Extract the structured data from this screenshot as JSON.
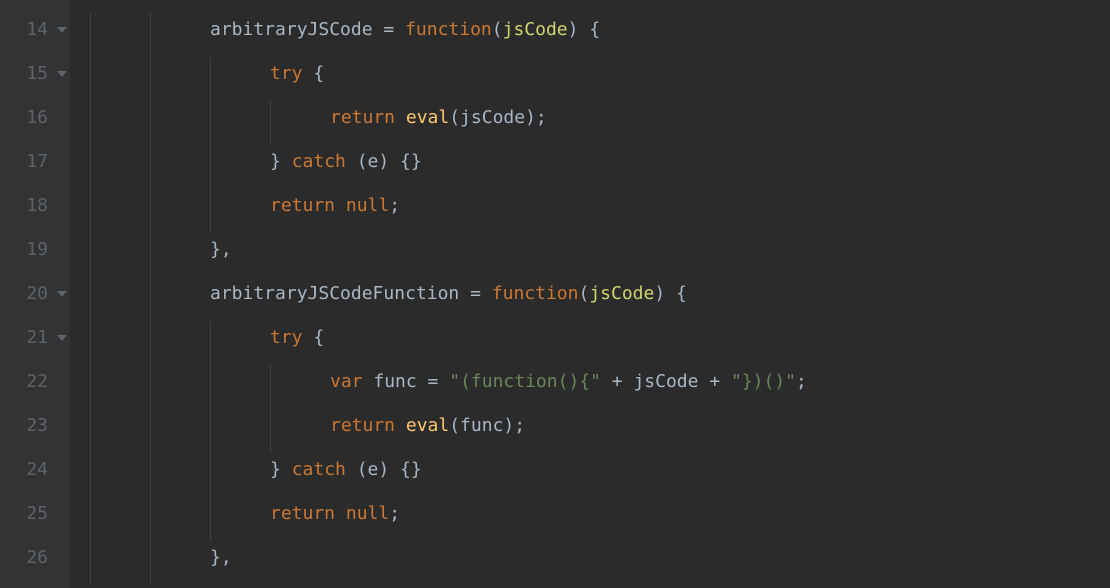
{
  "gutter": {
    "start": 14,
    "end": 26,
    "foldable": [
      14,
      15,
      20,
      21
    ]
  },
  "code": {
    "lines": [
      {
        "n": 14,
        "indent": 2,
        "tokens": [
          {
            "t": "arbitraryJSCode ",
            "c": "tk-default"
          },
          {
            "t": "= ",
            "c": "tk-op"
          },
          {
            "t": "function",
            "c": "tk-keyword"
          },
          {
            "t": "(",
            "c": "tk-paren"
          },
          {
            "t": "jsCode",
            "c": "tk-param"
          },
          {
            "t": ") {",
            "c": "tk-paren"
          }
        ]
      },
      {
        "n": 15,
        "indent": 3,
        "tokens": [
          {
            "t": "try",
            "c": "tk-keyword"
          },
          {
            "t": " {",
            "c": "tk-brace"
          }
        ]
      },
      {
        "n": 16,
        "indent": 4,
        "tokens": [
          {
            "t": "return ",
            "c": "tk-keyword"
          },
          {
            "t": "eval",
            "c": "tk-func"
          },
          {
            "t": "(jsCode);",
            "c": "tk-paren"
          }
        ]
      },
      {
        "n": 17,
        "indent": 3,
        "tokens": [
          {
            "t": "} ",
            "c": "tk-brace"
          },
          {
            "t": "catch",
            "c": "tk-keyword"
          },
          {
            "t": " (e) {}",
            "c": "tk-paren"
          }
        ]
      },
      {
        "n": 18,
        "indent": 3,
        "tokens": [
          {
            "t": "return ",
            "c": "tk-keyword"
          },
          {
            "t": "null",
            "c": "tk-null"
          },
          {
            "t": ";",
            "c": "tk-default"
          }
        ]
      },
      {
        "n": 19,
        "indent": 2,
        "tokens": [
          {
            "t": "},",
            "c": "tk-brace"
          }
        ]
      },
      {
        "n": 20,
        "indent": 2,
        "tokens": [
          {
            "t": "arbitraryJSCodeFunction ",
            "c": "tk-default"
          },
          {
            "t": "= ",
            "c": "tk-op"
          },
          {
            "t": "function",
            "c": "tk-keyword"
          },
          {
            "t": "(",
            "c": "tk-paren"
          },
          {
            "t": "jsCode",
            "c": "tk-param"
          },
          {
            "t": ") {",
            "c": "tk-paren"
          }
        ]
      },
      {
        "n": 21,
        "indent": 3,
        "tokens": [
          {
            "t": "try",
            "c": "tk-keyword"
          },
          {
            "t": " {",
            "c": "tk-brace"
          }
        ]
      },
      {
        "n": 22,
        "indent": 4,
        "tokens": [
          {
            "t": "var",
            "c": "tk-keyword"
          },
          {
            "t": " func ",
            "c": "tk-default"
          },
          {
            "t": "= ",
            "c": "tk-op"
          },
          {
            "t": "\"(function(){\"",
            "c": "tk-string"
          },
          {
            "t": " + jsCode + ",
            "c": "tk-default"
          },
          {
            "t": "\"})()\"",
            "c": "tk-string"
          },
          {
            "t": ";",
            "c": "tk-default"
          }
        ]
      },
      {
        "n": 23,
        "indent": 4,
        "tokens": [
          {
            "t": "return ",
            "c": "tk-keyword"
          },
          {
            "t": "eval",
            "c": "tk-func"
          },
          {
            "t": "(func);",
            "c": "tk-paren"
          }
        ]
      },
      {
        "n": 24,
        "indent": 3,
        "tokens": [
          {
            "t": "} ",
            "c": "tk-brace"
          },
          {
            "t": "catch",
            "c": "tk-keyword"
          },
          {
            "t": " (e) {}",
            "c": "tk-paren"
          }
        ]
      },
      {
        "n": 25,
        "indent": 3,
        "tokens": [
          {
            "t": "return ",
            "c": "tk-keyword"
          },
          {
            "t": "null",
            "c": "tk-null"
          },
          {
            "t": ";",
            "c": "tk-default"
          }
        ]
      },
      {
        "n": 26,
        "indent": 2,
        "tokens": [
          {
            "t": "},",
            "c": "tk-brace"
          }
        ]
      }
    ]
  }
}
